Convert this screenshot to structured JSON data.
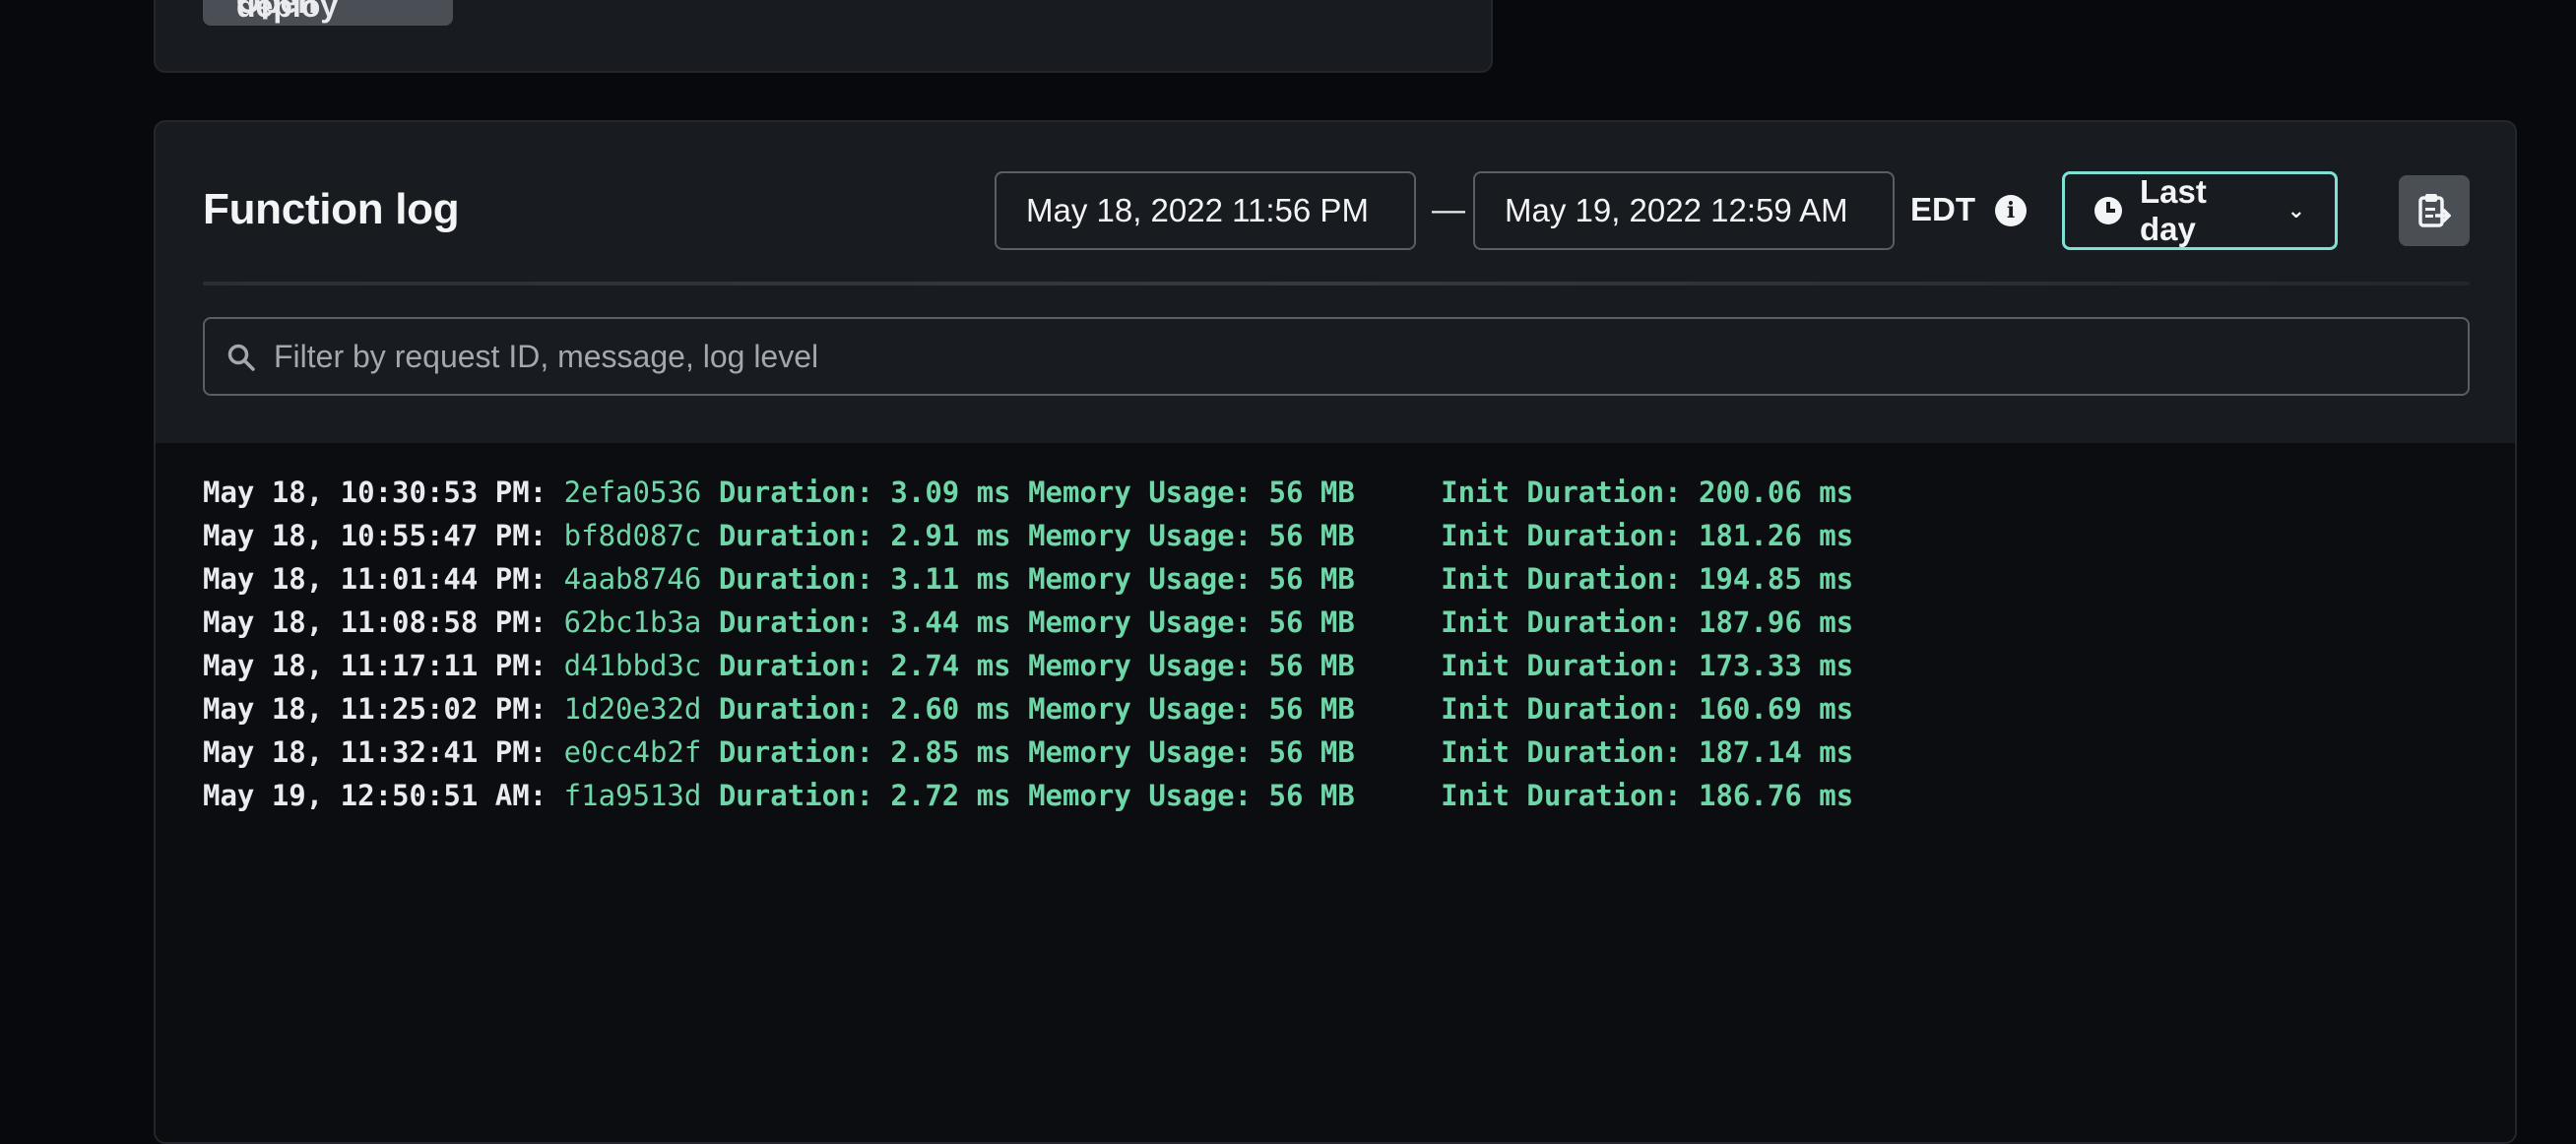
{
  "top_card": {
    "button_label": "Open deploy"
  },
  "function_log": {
    "title": "Function log",
    "start_date": "May 18, 2022 11:56 PM",
    "separator": "—",
    "end_date": "May 19, 2022 12:59 AM",
    "timezone": "EDT",
    "range_label": "Last day",
    "search_placeholder": "Filter by request ID, message, log level",
    "entries": [
      {
        "timestamp": "May 18, 10:30:53 PM:",
        "request_id": "2efa0536",
        "message": "Duration: 3.09 ms Memory Usage: 56 MB     Init Duration: 200.06 ms"
      },
      {
        "timestamp": "May 18, 10:55:47 PM:",
        "request_id": "bf8d087c",
        "message": "Duration: 2.91 ms Memory Usage: 56 MB     Init Duration: 181.26 ms"
      },
      {
        "timestamp": "May 18, 11:01:44 PM:",
        "request_id": "4aab8746",
        "message": "Duration: 3.11 ms Memory Usage: 56 MB     Init Duration: 194.85 ms"
      },
      {
        "timestamp": "May 18, 11:08:58 PM:",
        "request_id": "62bc1b3a",
        "message": "Duration: 3.44 ms Memory Usage: 56 MB     Init Duration: 187.96 ms"
      },
      {
        "timestamp": "May 18, 11:17:11 PM:",
        "request_id": "d41bbd3c",
        "message": "Duration: 2.74 ms Memory Usage: 56 MB     Init Duration: 173.33 ms"
      },
      {
        "timestamp": "May 18, 11:25:02 PM:",
        "request_id": "1d20e32d",
        "message": "Duration: 2.60 ms Memory Usage: 56 MB     Init Duration: 160.69 ms"
      },
      {
        "timestamp": "May 18, 11:32:41 PM:",
        "request_id": "e0cc4b2f",
        "message": "Duration: 2.85 ms Memory Usage: 56 MB     Init Duration: 187.14 ms"
      },
      {
        "timestamp": "May 19, 12:50:51 AM:",
        "request_id": "f1a9513d",
        "message": "Duration: 2.72 ms Memory Usage: 56 MB     Init Duration: 186.76 ms"
      }
    ]
  },
  "colors": {
    "accent": "#7fe0d6",
    "log_green": "#6fd6a8",
    "background": "#07090c",
    "card": "#181b1f"
  }
}
